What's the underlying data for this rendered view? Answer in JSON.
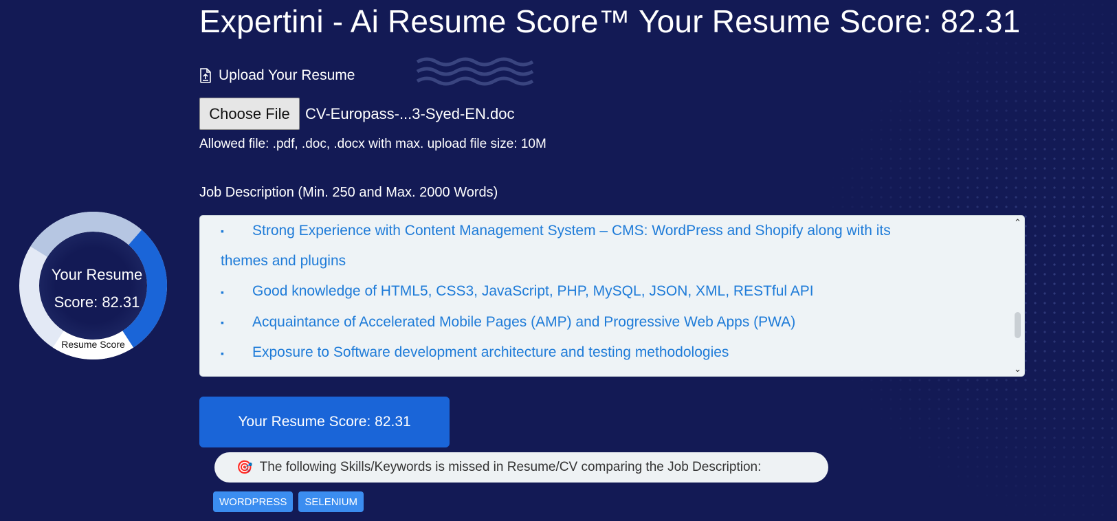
{
  "page": {
    "title": "Expertini - Ai Resume Score™ Your Resume Score: 82.31"
  },
  "upload": {
    "label": "Upload Your Resume",
    "choose_file_label": "Choose File",
    "file_name": "CV-Europass-...3-Syed-EN.doc",
    "allowed_text": "Allowed file: .pdf, .doc, .docx with max. upload file size: 10M"
  },
  "job_description": {
    "label": "Job Description (Min. 250 and Max. 2000 Words)",
    "lines": [
      "Strong Experience with Content Management System – CMS: WordPress and Shopify along with its",
      "themes and plugins",
      "Good knowledge of HTML5, CSS3, JavaScript, PHP, MySQL, JSON, XML, RESTful API",
      "Acquaintance of Accelerated Mobile Pages (AMP) and Progressive Web Apps (PWA)",
      "Exposure to Software development architecture and testing methodologies"
    ],
    "bullet": "▪"
  },
  "gauge": {
    "line1": "Your Resume",
    "line2": "Score: 82.31",
    "caption": "Resume Score",
    "score": 82.31
  },
  "score_button": {
    "label": "Your Resume Score: 82.31"
  },
  "missed": {
    "icon": "🎯",
    "text": "The following Skills/Keywords is missed in Resume/CV comparing the Job Description:",
    "tags": [
      "WORDPRESS",
      "SELENIUM"
    ]
  },
  "colors": {
    "background": "#131a55",
    "accent": "#1a65d8",
    "jd_text": "#1e7bd8",
    "tag": "#3b8df0"
  }
}
